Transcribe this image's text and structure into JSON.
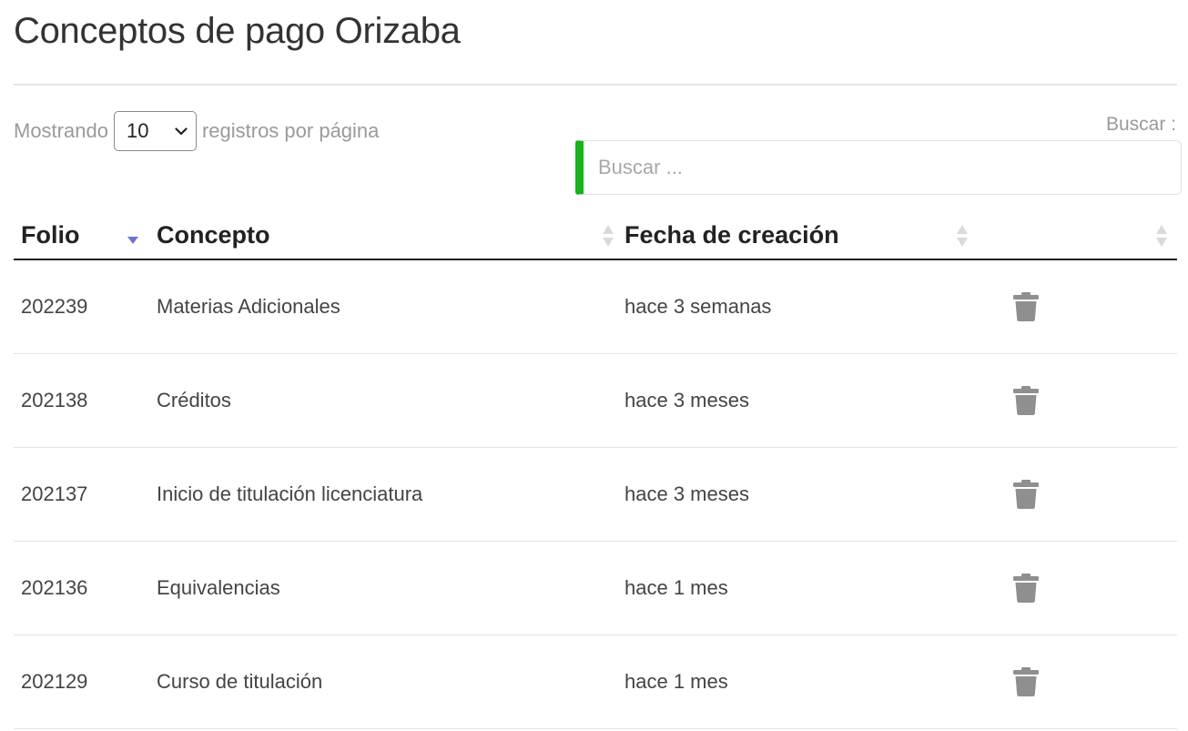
{
  "page": {
    "title": "Conceptos de pago Orizaba"
  },
  "length_control": {
    "prefix": "Mostrando",
    "selected": "10",
    "suffix": "registros por página"
  },
  "search": {
    "label": "Buscar :",
    "placeholder": "Buscar ...",
    "value": "",
    "accent_color": "#18b21c"
  },
  "table": {
    "columns": [
      "Folio",
      "Concepto",
      "Fecha de creación",
      ""
    ],
    "sort": {
      "column": "Folio",
      "direction": "descending",
      "active_color": "#6f73d3"
    },
    "rows": [
      {
        "folio": "202239",
        "concepto": "Materias Adicionales",
        "fecha": "hace 3 semanas",
        "action_icon": "trash-icon"
      },
      {
        "folio": "202138",
        "concepto": "Créditos",
        "fecha": "hace 3 meses",
        "action_icon": "trash-icon"
      },
      {
        "folio": "202137",
        "concepto": "Inicio de titulación licenciatura",
        "fecha": "hace 3 meses",
        "action_icon": "trash-icon"
      },
      {
        "folio": "202136",
        "concepto": "Equivalencias",
        "fecha": "hace 1 mes",
        "action_icon": "trash-icon"
      },
      {
        "folio": "202129",
        "concepto": "Curso de titulación",
        "fecha": "hace 1 mes",
        "action_icon": "trash-icon"
      }
    ]
  }
}
